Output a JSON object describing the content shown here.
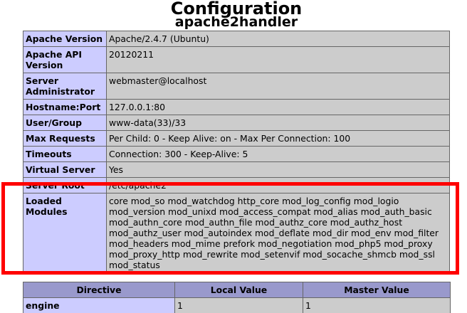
{
  "header": {
    "title": "Configuration",
    "subtitle": "apache2handler"
  },
  "config_rows": [
    {
      "label": "Apache Version",
      "value": "Apache/2.4.7 (Ubuntu)"
    },
    {
      "label": "Apache API Version",
      "value": "20120211"
    },
    {
      "label": "Server Administrator",
      "value": "webmaster@localhost"
    },
    {
      "label": "Hostname:Port",
      "value": "127.0.0.1:80"
    },
    {
      "label": "User/Group",
      "value": "www-data(33)/33"
    },
    {
      "label": "Max Requests",
      "value": "Per Child: 0 - Keep Alive: on - Max Per Connection: 100"
    },
    {
      "label": "Timeouts",
      "value": "Connection: 300 - Keep-Alive: 5"
    },
    {
      "label": "Virtual Server",
      "value": "Yes"
    },
    {
      "label": "Server Root",
      "value": "/etc/apache2"
    },
    {
      "label": "Loaded Modules",
      "value": "core mod_so mod_watchdog http_core mod_log_config mod_logio mod_version mod_unixd mod_access_compat mod_alias mod_auth_basic mod_authn_core mod_authn_file mod_authz_core mod_authz_host mod_authz_user mod_autoindex mod_deflate mod_dir mod_env mod_filter mod_headers mod_mime prefork mod_negotiation mod_php5 mod_proxy mod_proxy_http mod_rewrite mod_setenvif mod_socache_shmcb mod_ssl mod_status"
    }
  ],
  "directive_table": {
    "headers": [
      "Directive",
      "Local Value",
      "Master Value"
    ],
    "rows": [
      {
        "directive": "engine",
        "local": "1",
        "master": "1"
      }
    ]
  },
  "colors": {
    "label_bg": "#ccccff",
    "value_bg": "#cccccc",
    "header_bg": "#9999cc",
    "highlight": "#ff0000"
  }
}
